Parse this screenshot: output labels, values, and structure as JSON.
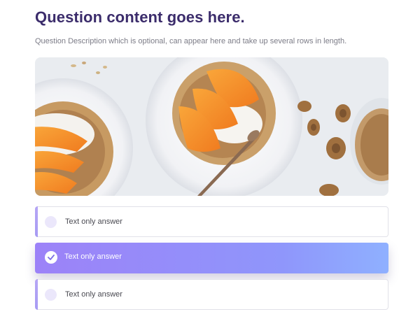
{
  "question": {
    "title": "Question content goes here.",
    "description": "Question Description which is optional, can appear here and take up several rows in length."
  },
  "image": {
    "subject": "granola-bowl-with-peach-slices-and-walnuts"
  },
  "answers": [
    {
      "label": "Text only answer",
      "selected": false
    },
    {
      "label": "Text only answer",
      "selected": true
    },
    {
      "label": "Text only answer",
      "selected": false
    }
  ],
  "colors": {
    "title": "#3b2c6b",
    "accent": "#a79bf4",
    "selected_gradient_start": "#9c82f8",
    "selected_gradient_end": "#8fb0ff",
    "radio_unselected": "#ebe7fb"
  }
}
